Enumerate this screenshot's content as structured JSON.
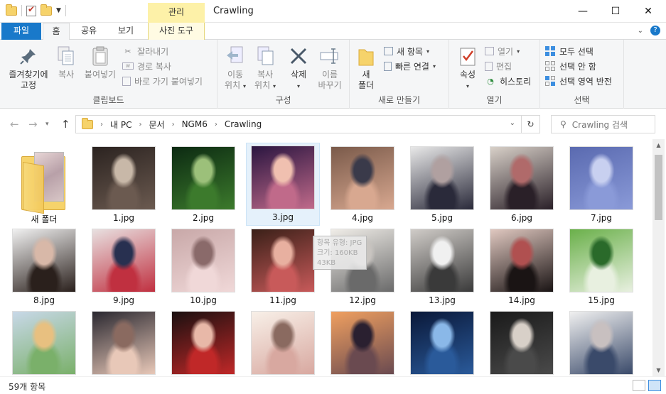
{
  "window": {
    "title": "Crawling",
    "context_tab_header": "관리",
    "controls": {
      "minimize": "—",
      "maximize": "☐",
      "close": "✕"
    }
  },
  "ribbon_tabs": {
    "file": "파일",
    "home": "홈",
    "share": "공유",
    "view": "보기",
    "picture_tools": "사진 도구"
  },
  "ribbon": {
    "clipboard": {
      "label": "클립보드",
      "pin_line1": "즐겨찾기에",
      "pin_line2": "고정",
      "copy": "복사",
      "paste": "붙여넣기",
      "cut": "잘라내기",
      "copy_path": "경로 복사",
      "paste_shortcut": "바로 가기 붙여넣기"
    },
    "organize": {
      "label": "구성",
      "move_line1": "이동",
      "move_line2": "위치",
      "copyto_line1": "복사",
      "copyto_line2": "위치",
      "delete": "삭제",
      "rename_line1": "이름",
      "rename_line2": "바꾸기"
    },
    "new": {
      "label": "새로 만들기",
      "new_folder_line1": "새",
      "new_folder_line2": "폴더",
      "new_item": "새 항목",
      "easy_access": "빠른 연결"
    },
    "open": {
      "label": "열기",
      "properties": "속성",
      "open": "열기",
      "edit": "편집",
      "history": "히스토리"
    },
    "select": {
      "label": "선택",
      "select_all": "모두 선택",
      "select_none": "선택 안 함",
      "invert_selection": "선택 영역 반전"
    }
  },
  "address_bar": {
    "crumbs": [
      "내 PC",
      "문서",
      "NGM6",
      "Crawling"
    ],
    "search_placeholder": "Crawling 검색"
  },
  "files": [
    {
      "name": "새 폴더",
      "type": "folder"
    },
    {
      "name": "1.jpg",
      "colors": [
        "#2b2320",
        "#6b5a50",
        "#c8b8a8"
      ]
    },
    {
      "name": "2.jpg",
      "colors": [
        "#0c2a12",
        "#3c7a2c",
        "#9cc07a"
      ]
    },
    {
      "name": "3.jpg",
      "colors": [
        "#2a1540",
        "#c06a8a",
        "#f0c0b0"
      ],
      "selected": true
    },
    {
      "name": "4.jpg",
      "colors": [
        "#7a5a4a",
        "#d8a890",
        "#3a3a4a"
      ]
    },
    {
      "name": "5.jpg",
      "colors": [
        "#e8e8e8",
        "#2a2a3a",
        "#b0a0a0"
      ]
    },
    {
      "name": "6.jpg",
      "colors": [
        "#d8d0c8",
        "#2a2028",
        "#b06a6a"
      ]
    },
    {
      "name": "7.jpg",
      "colors": [
        "#5a6ab0",
        "#8a9ad8",
        "#c8d0f0"
      ]
    },
    {
      "name": "8.jpg",
      "colors": [
        "#f0f0f0",
        "#2a201c",
        "#d8b8a8"
      ]
    },
    {
      "name": "9.jpg",
      "colors": [
        "#e8e0e0",
        "#c03040",
        "#283050"
      ]
    },
    {
      "name": "10.jpg",
      "colors": [
        "#c8a8a8",
        "#f0d8d8",
        "#8a6a6a"
      ]
    },
    {
      "name": "11.jpg",
      "colors": [
        "#3a2018",
        "#c85a5a",
        "#e8b0a0"
      ]
    },
    {
      "name": "12.jpg",
      "colors": [
        "#f0ede8",
        "#6a6a6a",
        "#c8c4c0"
      ]
    },
    {
      "name": "13.jpg",
      "colors": [
        "#d0ccc8",
        "#3a3a3a",
        "#f0f0f0"
      ]
    },
    {
      "name": "14.jpg",
      "colors": [
        "#e0c8c0",
        "#1a1414",
        "#b05050"
      ]
    },
    {
      "name": "15.jpg",
      "colors": [
        "#6ab04a",
        "#e8f0e0",
        "#2a6a2a"
      ]
    },
    {
      "name": "",
      "colors": [
        "#c8d8e8",
        "#7ab06a",
        "#e8c080"
      ]
    },
    {
      "name": "",
      "colors": [
        "#2a2830",
        "#e8c8b8",
        "#8a6a60"
      ]
    },
    {
      "name": "",
      "colors": [
        "#1a1010",
        "#c02828",
        "#e8b8a8"
      ]
    },
    {
      "name": "",
      "colors": [
        "#f8f0e8",
        "#d8a8a0",
        "#8a6a60"
      ]
    },
    {
      "name": "",
      "colors": [
        "#f0a060",
        "#6a4a50",
        "#2a2030"
      ]
    },
    {
      "name": "",
      "colors": [
        "#0a1838",
        "#2a5a9a",
        "#8ab8e8"
      ]
    },
    {
      "name": "",
      "colors": [
        "#1a1a1a",
        "#4a4a4a",
        "#d8d0c8"
      ]
    },
    {
      "name": "",
      "colors": [
        "#f0f0f0",
        "#3a4a6a",
        "#c8c0c0"
      ]
    }
  ],
  "tooltip": {
    "line1": "항목 유형: JPG",
    "line2": "크기: 160KB",
    "line3": "43KB"
  },
  "status": {
    "count": "59개 항목"
  }
}
